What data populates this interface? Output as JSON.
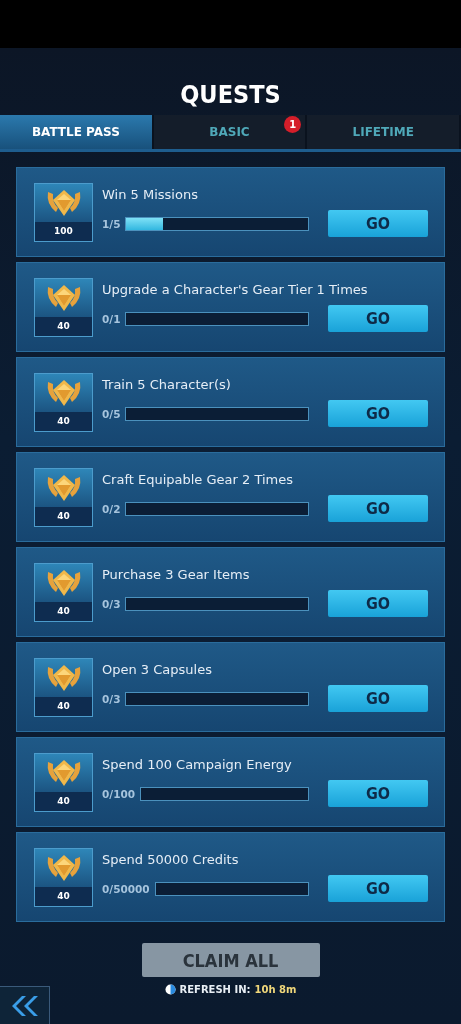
{
  "title": "QUESTS",
  "tabs": [
    {
      "label": "BATTLE PASS",
      "selected": true
    },
    {
      "label": "BASIC",
      "selected": false,
      "badge": "1"
    },
    {
      "label": "LIFETIME",
      "selected": false
    }
  ],
  "quests": [
    {
      "reward": "100",
      "title": "Win 5 Missions",
      "progress": "1/5",
      "level": 0.2,
      "button": "GO"
    },
    {
      "reward": "40",
      "title": "Upgrade a Character's Gear Tier 1 Times",
      "progress": "0/1",
      "level": 0,
      "button": "GO"
    },
    {
      "reward": "40",
      "title": "Train 5 Character(s)",
      "progress": "0/5",
      "level": 0,
      "button": "GO"
    },
    {
      "reward": "40",
      "title": "Craft Equipable Gear 2 Times",
      "progress": "0/2",
      "level": 0,
      "button": "GO"
    },
    {
      "reward": "40",
      "title": "Purchase 3 Gear Items",
      "progress": "0/3",
      "level": 0,
      "button": "GO"
    },
    {
      "reward": "40",
      "title": "Open 3 Capsules",
      "progress": "0/3",
      "level": 0,
      "button": "GO"
    },
    {
      "reward": "40",
      "title": "Spend 100 Campaign Energy",
      "progress": "0/100",
      "level": 0,
      "button": "GO"
    },
    {
      "reward": "40",
      "title": "Spend 50000 Credits",
      "progress": "0/50000",
      "level": 0,
      "button": "GO"
    }
  ],
  "claim_all": {
    "label": "CLAIM ALL",
    "disabled": true
  },
  "refresh": {
    "label": "REFRESH IN:",
    "time": "10h 8m"
  }
}
